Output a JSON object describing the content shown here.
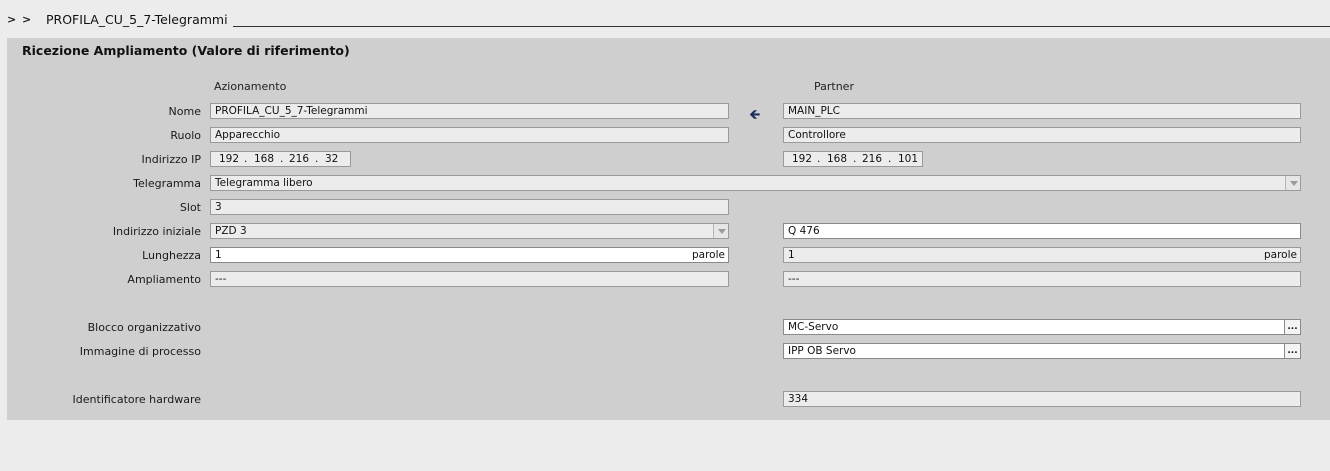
{
  "breadcrumb": {
    "chevrons": [
      ">",
      ">"
    ],
    "title": "PROFILA_CU_5_7-Telegrammi"
  },
  "section_title": "Ricezione Ampliamento (Valore di riferimento)",
  "columns": {
    "drive": "Azionamento",
    "partner": "Partner"
  },
  "labels": {
    "name": "Nome",
    "role": "Ruolo",
    "ip": "Indirizzo IP",
    "telegram": "Telegramma",
    "slot": "Slot",
    "start_address": "Indirizzo iniziale",
    "length": "Lunghezza",
    "extension": "Ampliamento",
    "org_block": "Blocco organizzativo",
    "process_image": "Immagine di processo",
    "hw_id": "Identificatore hardware"
  },
  "drive": {
    "name": "PROFILA_CU_5_7-Telegrammi",
    "role": "Apparecchio",
    "ip": [
      "192",
      "168",
      "216",
      "32"
    ],
    "telegram": "Telegramma libero",
    "slot": "3",
    "start_address": "PZD 3",
    "length": "1",
    "length_unit": "parole",
    "extension": "---"
  },
  "partner": {
    "name": "MAIN_PLC",
    "role": "Controllore",
    "ip": [
      "192",
      "168",
      "216",
      "101"
    ],
    "start_address": "Q 476",
    "length": "1",
    "length_unit": "parole",
    "extension": "---",
    "org_block": "MC-Servo",
    "process_image": "IPP OB Servo",
    "hw_id": "334"
  },
  "ip_separator": ".",
  "icons": {
    "arrow": "arrow-left-icon",
    "dots": "..."
  }
}
